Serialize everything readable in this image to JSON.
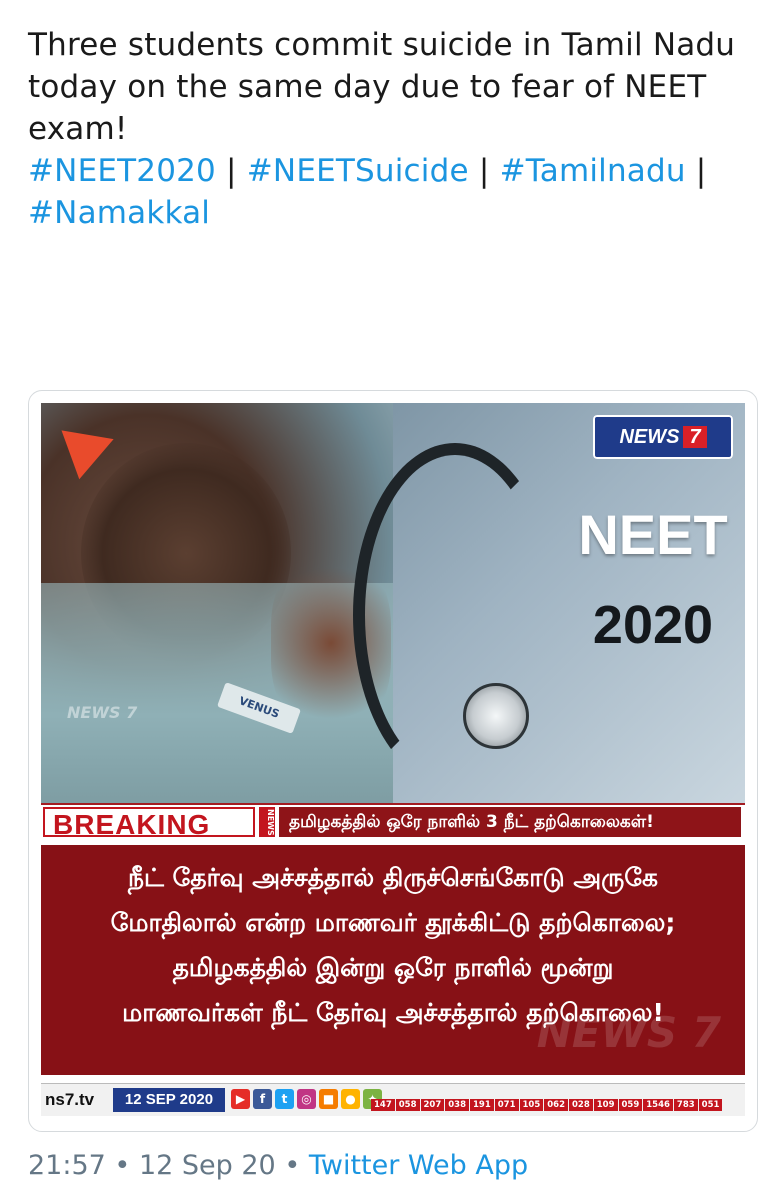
{
  "tweet": {
    "text_line1": "Three students commit suicide in Tamil Nadu today on the same day due to fear of NEET exam!",
    "hashtags": [
      "#NEET2020",
      "#NEETSuicide",
      "#Tamilnadu",
      "#Namakkal"
    ],
    "separator": "|"
  },
  "media": {
    "logo_brand": "NEWS",
    "logo_number": "7",
    "neet_title": "NEET",
    "neet_year": "2020",
    "shirt_badge": "VENUS",
    "watermark": "NEWS 7",
    "breaking_label": "BREAKING",
    "breaking_tag": "NEWS",
    "breaking_ticker": "தமிழகத்தில் ஒரே நாளில் 3 நீட் தற்கொலைகள்!",
    "headline_lines": [
      "நீட் தேர்வு அச்சத்தால் திருச்செங்கோடு அருகே",
      "மோதிலால் என்ற மாணவர் தூக்கிட்டு தற்கொலை;",
      "தமிழகத்தில் இன்று ஒரே நாளில் மூன்று",
      "மாணவர்கள் நீட் தேர்வு அச்சத்தால் தற்கொலை!"
    ],
    "footer_site": "ns7.tv",
    "footer_date": "12 SEP 2020",
    "channel_numbers": [
      "147",
      "058",
      "207",
      "038",
      "191",
      "071",
      "105",
      "062",
      "028",
      "109",
      "059",
      "1546",
      "783",
      "051"
    ]
  },
  "meta": {
    "time": "21:57",
    "dot": "•",
    "date": "12 Sep 20",
    "source": "Twitter Web App"
  },
  "colors": {
    "hashtag": "#1b95e0",
    "breaking_red": "#c3151e",
    "headline_bg": "#871116",
    "brand_blue": "#1f3b8a"
  }
}
